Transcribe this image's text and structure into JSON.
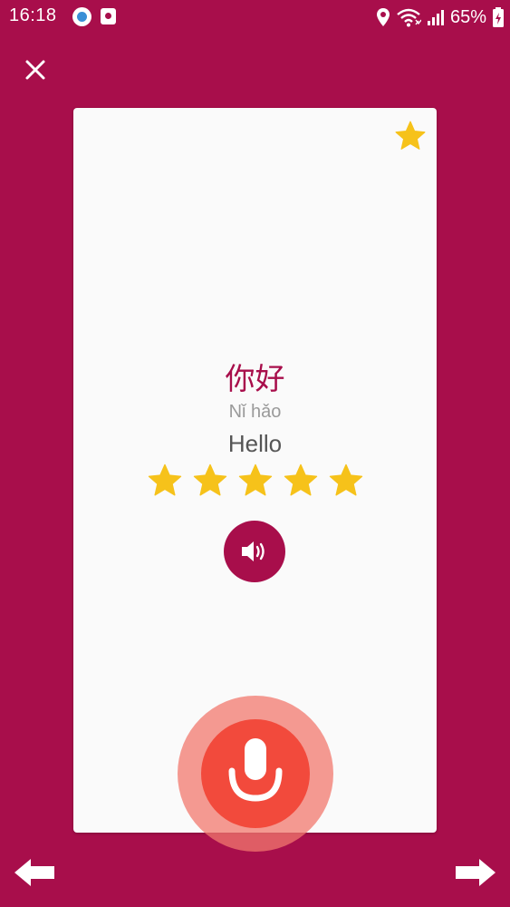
{
  "status_bar": {
    "time": "16:18",
    "battery": "65%",
    "icons": [
      "app-notification-icon",
      "app-notification-icon-2",
      "location-icon",
      "wifi-icon",
      "signal-icon",
      "battery-charging-icon"
    ]
  },
  "toolbar": {
    "close_icon": "close-icon"
  },
  "card": {
    "favorite_icon": "star-icon",
    "hanzi": "你好",
    "pinyin": "Nǐ hǎo",
    "meaning": "Hello",
    "rating": {
      "value": 5,
      "max": 5
    },
    "audio_icon": "speaker-icon"
  },
  "mic": {
    "icon": "microphone-icon"
  },
  "navigation": {
    "prev_icon": "arrow-left-icon",
    "next_icon": "arrow-right-icon"
  },
  "colors": {
    "background": "#A80E4B",
    "card": "#FAFAFA",
    "star": "#F6C21A",
    "mic": "#F24A3C",
    "hanzi": "#A80E4B"
  }
}
